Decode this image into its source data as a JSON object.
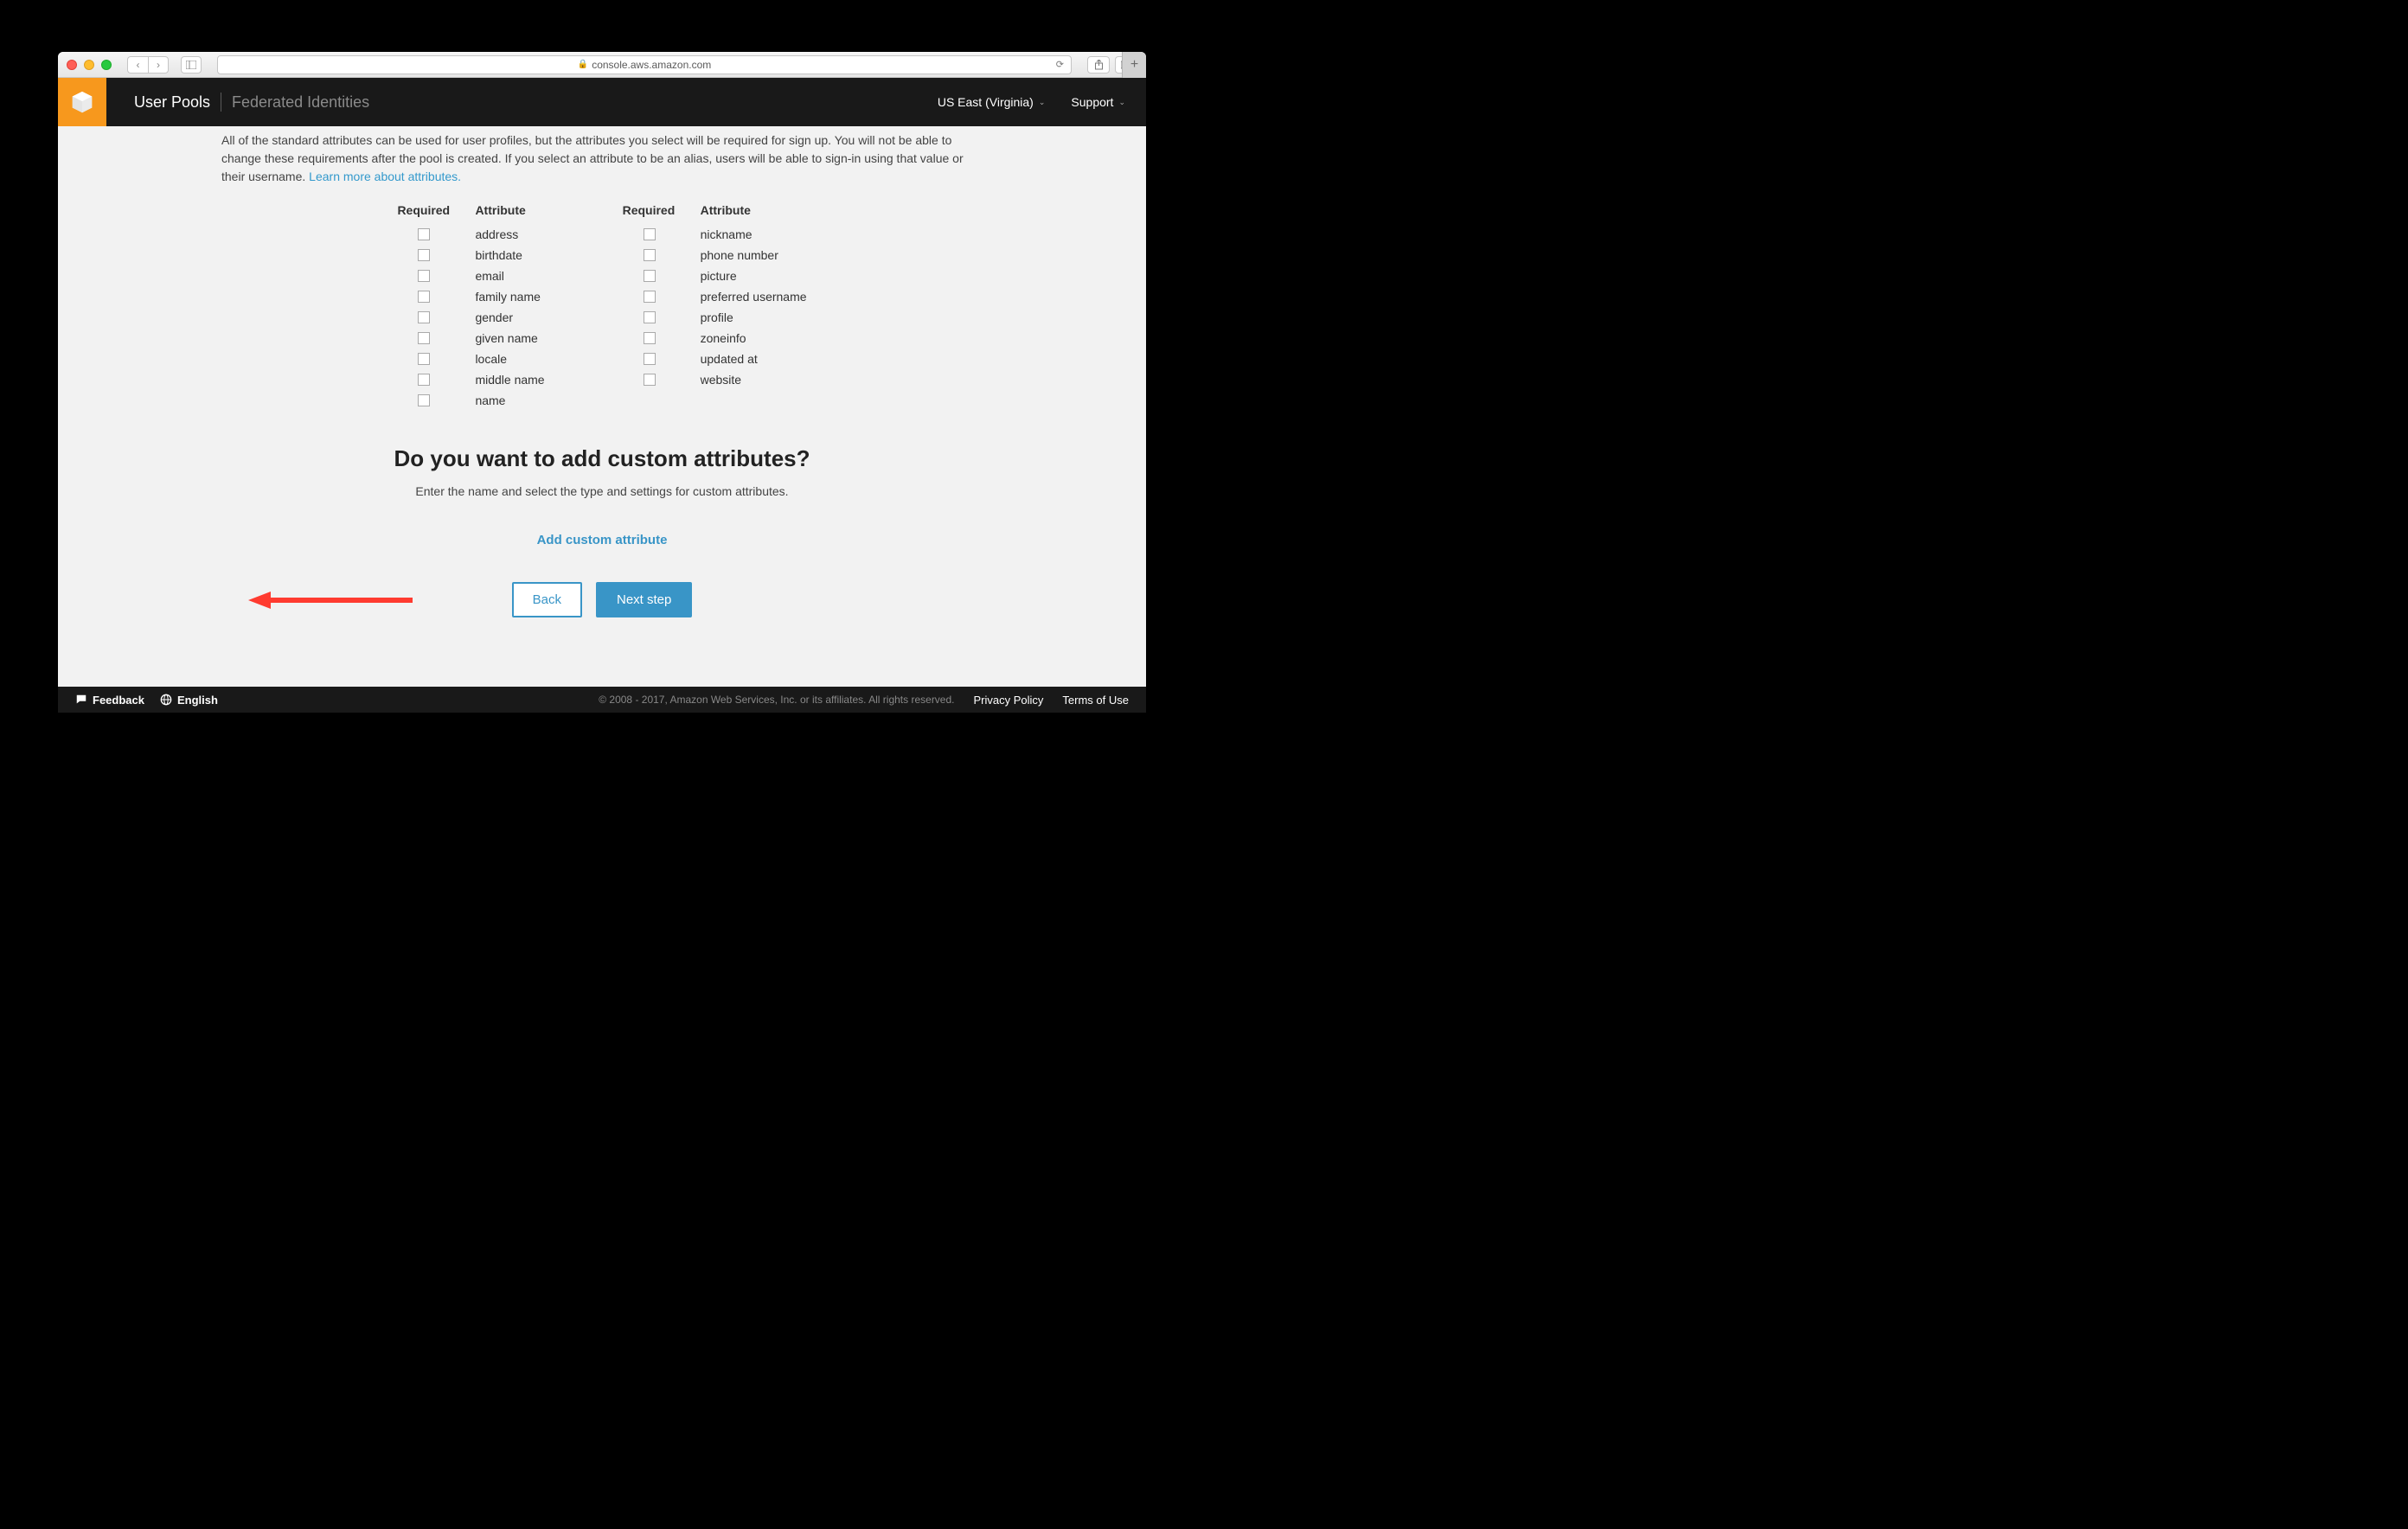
{
  "browser": {
    "url": "console.aws.amazon.com"
  },
  "header": {
    "nav": {
      "user_pools": "User Pools",
      "federated": "Federated Identities"
    },
    "region": "US East (Virginia)",
    "support": "Support"
  },
  "intro": {
    "text1": "All of the standard attributes can be used for user profiles, but the attributes you select will be required for sign up. You will not be able to change these requirements after the pool is created. If you select an attribute to be an alias, users will be able to sign-in using that value or their username.",
    "learn_more": "Learn more about attributes."
  },
  "attributes": {
    "col_headers": {
      "required": "Required",
      "attribute": "Attribute"
    },
    "left": [
      "address",
      "birthdate",
      "email",
      "family name",
      "gender",
      "given name",
      "locale",
      "middle name",
      "name"
    ],
    "right": [
      "nickname",
      "phone number",
      "picture",
      "preferred username",
      "profile",
      "zoneinfo",
      "updated at",
      "website"
    ]
  },
  "custom": {
    "heading": "Do you want to add custom attributes?",
    "subtext": "Enter the name and select the type and settings for custom attributes.",
    "add_link": "Add custom attribute"
  },
  "buttons": {
    "back": "Back",
    "next": "Next step"
  },
  "footer": {
    "feedback": "Feedback",
    "english": "English",
    "copyright": "© 2008 - 2017, Amazon Web Services, Inc. or its affiliates. All rights reserved.",
    "privacy": "Privacy Policy",
    "terms": "Terms of Use"
  }
}
